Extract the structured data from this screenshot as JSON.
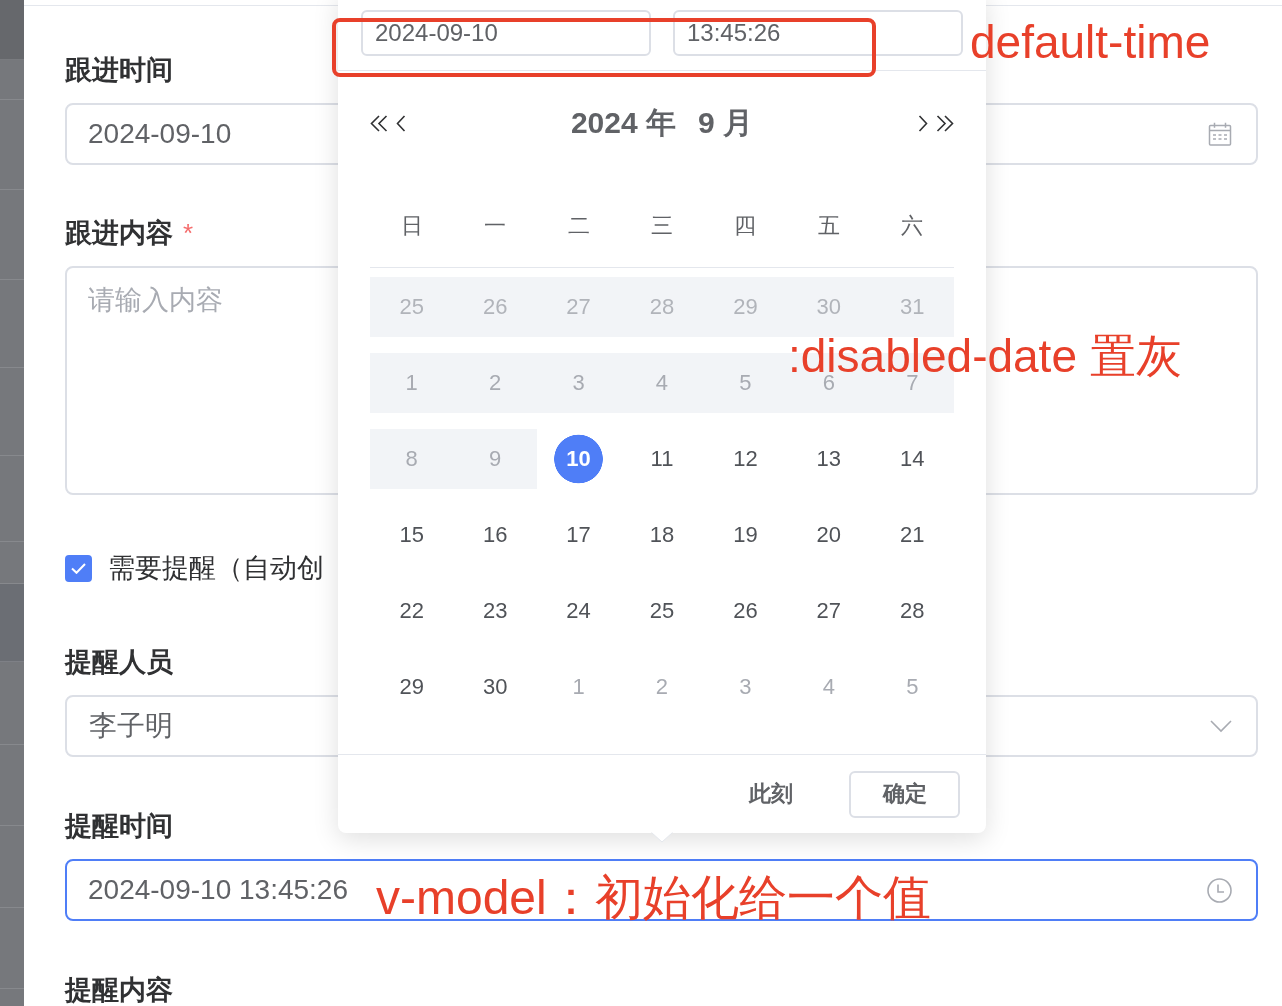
{
  "form": {
    "fields": [
      {
        "kind": "date",
        "label": "跟进时间",
        "value": "2024-09-10",
        "focused": false
      },
      {
        "kind": "textarea",
        "label": "跟进内容",
        "required_mark": "*",
        "placeholder": "请输入内容",
        "focused": false
      },
      {
        "kind": "checkbox",
        "label": "需要提醒（自动创",
        "checked": true
      },
      {
        "kind": "select",
        "label": "提醒人员",
        "value": "李子明",
        "focused": false
      },
      {
        "kind": "datetime",
        "label": "提醒时间",
        "value": "2024-09-10 13:45:26",
        "focused": true
      },
      {
        "kind": "label",
        "label": "提醒内容"
      }
    ]
  },
  "date_picker": {
    "date_input": {
      "value": "2024-09-10"
    },
    "time_input": {
      "value": "13:45:26"
    },
    "year_label": "2024 年",
    "month_label": "9 月",
    "weekdays": [
      "日",
      "一",
      "二",
      "三",
      "四",
      "五",
      "六"
    ],
    "weeks": [
      {
        "days": [
          {
            "day": "25",
            "kind": "prev-month",
            "disabled": true,
            "selected": false
          },
          {
            "day": "26",
            "kind": "prev-month",
            "disabled": true,
            "selected": false
          },
          {
            "day": "27",
            "kind": "prev-month",
            "disabled": true,
            "selected": false
          },
          {
            "day": "28",
            "kind": "prev-month",
            "disabled": true,
            "selected": false
          },
          {
            "day": "29",
            "kind": "prev-month",
            "disabled": true,
            "selected": false
          },
          {
            "day": "30",
            "kind": "prev-month",
            "disabled": true,
            "selected": false
          },
          {
            "day": "31",
            "kind": "prev-month",
            "disabled": true,
            "selected": false
          }
        ]
      },
      {
        "days": [
          {
            "day": "1",
            "kind": "current",
            "disabled": true,
            "selected": false
          },
          {
            "day": "2",
            "kind": "current",
            "disabled": true,
            "selected": false
          },
          {
            "day": "3",
            "kind": "current",
            "disabled": true,
            "selected": false
          },
          {
            "day": "4",
            "kind": "current",
            "disabled": true,
            "selected": false
          },
          {
            "day": "5",
            "kind": "current",
            "disabled": true,
            "selected": false
          },
          {
            "day": "6",
            "kind": "current",
            "disabled": true,
            "selected": false
          },
          {
            "day": "7",
            "kind": "current",
            "disabled": true,
            "selected": false
          }
        ]
      },
      {
        "days": [
          {
            "day": "8",
            "kind": "current",
            "disabled": true,
            "selected": false
          },
          {
            "day": "9",
            "kind": "current",
            "disabled": true,
            "selected": false
          },
          {
            "day": "10",
            "kind": "current",
            "disabled": false,
            "selected": true
          },
          {
            "day": "11",
            "kind": "current",
            "disabled": false,
            "selected": false
          },
          {
            "day": "12",
            "kind": "current",
            "disabled": false,
            "selected": false
          },
          {
            "day": "13",
            "kind": "current",
            "disabled": false,
            "selected": false
          },
          {
            "day": "14",
            "kind": "current",
            "disabled": false,
            "selected": false
          }
        ]
      },
      {
        "days": [
          {
            "day": "15",
            "kind": "current",
            "disabled": false,
            "selected": false
          },
          {
            "day": "16",
            "kind": "current",
            "disabled": false,
            "selected": false
          },
          {
            "day": "17",
            "kind": "current",
            "disabled": false,
            "selected": false
          },
          {
            "day": "18",
            "kind": "current",
            "disabled": false,
            "selected": false
          },
          {
            "day": "19",
            "kind": "current",
            "disabled": false,
            "selected": false
          },
          {
            "day": "20",
            "kind": "current",
            "disabled": false,
            "selected": false
          },
          {
            "day": "21",
            "kind": "current",
            "disabled": false,
            "selected": false
          }
        ]
      },
      {
        "days": [
          {
            "day": "22",
            "kind": "current",
            "disabled": false,
            "selected": false
          },
          {
            "day": "23",
            "kind": "current",
            "disabled": false,
            "selected": false
          },
          {
            "day": "24",
            "kind": "current",
            "disabled": false,
            "selected": false
          },
          {
            "day": "25",
            "kind": "current",
            "disabled": false,
            "selected": false
          },
          {
            "day": "26",
            "kind": "current",
            "disabled": false,
            "selected": false
          },
          {
            "day": "27",
            "kind": "current",
            "disabled": false,
            "selected": false
          },
          {
            "day": "28",
            "kind": "current",
            "disabled": false,
            "selected": false
          }
        ]
      },
      {
        "days": [
          {
            "day": "29",
            "kind": "current",
            "disabled": false,
            "selected": false
          },
          {
            "day": "30",
            "kind": "current",
            "disabled": false,
            "selected": false
          },
          {
            "day": "1",
            "kind": "next-month",
            "disabled": false,
            "selected": false
          },
          {
            "day": "2",
            "kind": "next-month",
            "disabled": false,
            "selected": false
          },
          {
            "day": "3",
            "kind": "next-month",
            "disabled": false,
            "selected": false
          },
          {
            "day": "4",
            "kind": "next-month",
            "disabled": false,
            "selected": false
          },
          {
            "day": "5",
            "kind": "next-month",
            "disabled": false,
            "selected": false
          }
        ]
      }
    ],
    "now_button": "此刻",
    "confirm_button": "确定"
  },
  "annotations": [
    {
      "kind": "frame"
    },
    {
      "kind": "note",
      "text": "default-time"
    },
    {
      "kind": "note",
      "text": ":disabled-date 置灰"
    },
    {
      "kind": "note",
      "text": "v-model：初始化给一个值"
    }
  ]
}
